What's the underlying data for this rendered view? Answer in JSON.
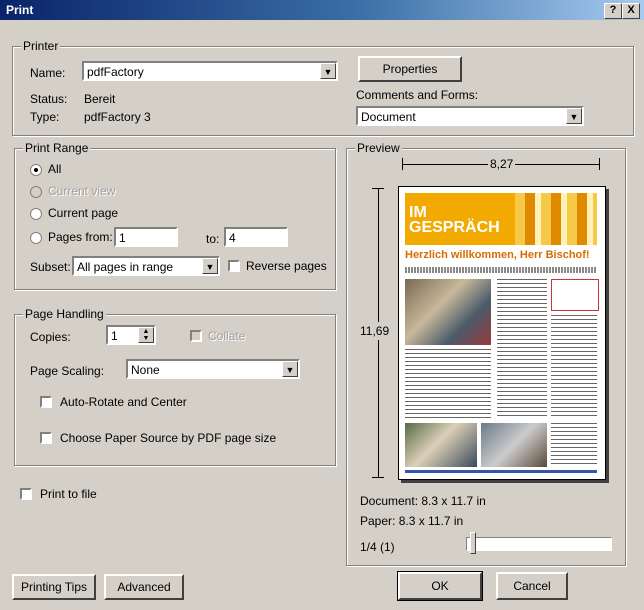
{
  "window": {
    "title": "Print",
    "help_glyph": "?",
    "close_glyph": "X"
  },
  "printer": {
    "group_label": "Printer",
    "name_label": "Name:",
    "name_value": "pdfFactory",
    "status_label": "Status:",
    "status_value": "Bereit",
    "type_label": "Type:",
    "type_value": "pdfFactory 3",
    "properties_button": "Properties",
    "comments_label": "Comments and Forms:",
    "comments_value": "Document"
  },
  "print_range": {
    "group_label": "Print Range",
    "all_label": "All",
    "current_view_label": "Current view",
    "current_page_label": "Current page",
    "pages_label": "Pages from:",
    "pages_from": "1",
    "to_label": "to:",
    "pages_to": "4",
    "subset_label": "Subset:",
    "subset_value": "All pages in range",
    "reverse_label": "Reverse pages"
  },
  "page_handling": {
    "group_label": "Page Handling",
    "copies_label": "Copies:",
    "copies_value": "1",
    "collate_label": "Collate",
    "scaling_label": "Page Scaling:",
    "scaling_value": "None",
    "autorotate_label": "Auto-Rotate and Center",
    "choose_paper_label": "Choose Paper Source by PDF page size"
  },
  "print_to_file_label": "Print to file",
  "preview": {
    "group_label": "Preview",
    "width_value": "8,27",
    "height_value": "11,69",
    "document_label": "Document: 8.3 x 11.7 in",
    "paper_label": "Paper: 8.3 x 11.7 in",
    "page_indicator": "1/4 (1)",
    "headline_logo": "IM GESPRÄCH",
    "headline": "Herzlich willkommen, Herr Bischof!"
  },
  "buttons": {
    "printing_tips": "Printing Tips",
    "advanced": "Advanced",
    "ok": "OK",
    "cancel": "Cancel"
  },
  "colors": {
    "titlebar": "#0a246a",
    "face": "#d4d0c8",
    "accent": "#f2a900"
  }
}
